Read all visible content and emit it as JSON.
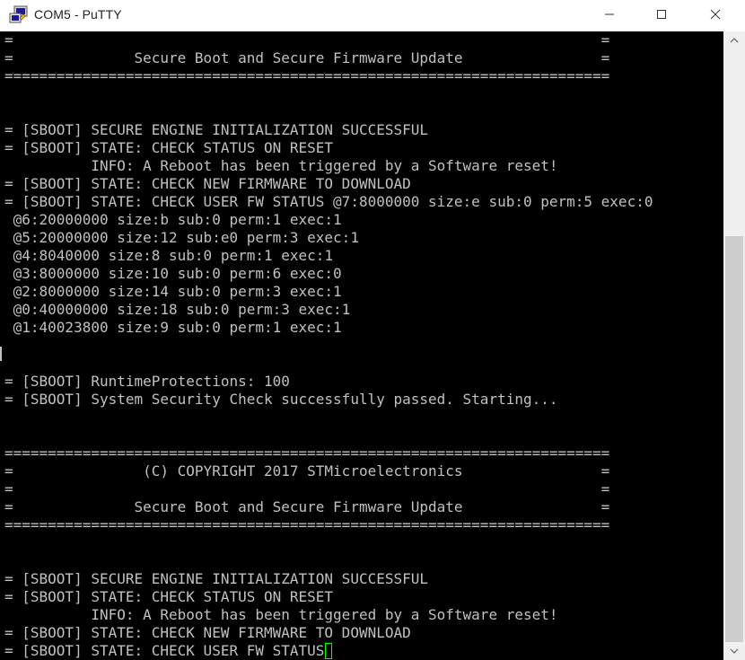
{
  "window": {
    "title": "COM5 - PuTTY"
  },
  "icons": {
    "app": "putty-app-icon",
    "minimize": "minimize-icon",
    "maximize": "maximize-icon",
    "close": "close-icon",
    "scroll_up": "scroll-up-arrow-icon",
    "scroll_down": "scroll-down-arrow-icon"
  },
  "colors": {
    "terminal_background": "#000000",
    "terminal_text": "#c0c0c0",
    "cursor": "#00ff00"
  },
  "terminal": {
    "lines": [
      "=                                                                    =",
      "=              Secure Boot and Secure Firmware Update                =",
      "======================================================================",
      "",
      "",
      "= [SBOOT] SECURE ENGINE INITIALIZATION SUCCESSFUL",
      "= [SBOOT] STATE: CHECK STATUS ON RESET",
      "          INFO: A Reboot has been triggered by a Software reset!",
      "= [SBOOT] STATE: CHECK NEW FIRMWARE TO DOWNLOAD",
      "= [SBOOT] STATE: CHECK USER FW STATUS @7:8000000 size:e sub:0 perm:5 exec:0",
      " @6:20000000 size:b sub:0 perm:1 exec:1",
      " @5:20000000 size:12 sub:e0 perm:3 exec:1",
      " @4:8040000 size:8 sub:0 perm:1 exec:1",
      " @3:8000000 size:10 sub:0 perm:6 exec:0",
      " @2:8000000 size:14 sub:0 perm:3 exec:1",
      " @0:40000000 size:18 sub:0 perm:3 exec:1",
      " @1:40023800 size:9 sub:0 perm:1 exec:1",
      "",
      "",
      "= [SBOOT] RuntimeProtections: 100",
      "= [SBOOT] System Security Check successfully passed. Starting...",
      "",
      "",
      "======================================================================",
      "=               (C) COPYRIGHT 2017 STMicroelectronics                =",
      "=                                                                    =",
      "=              Secure Boot and Secure Firmware Update                =",
      "======================================================================",
      "",
      "",
      "= [SBOOT] SECURE ENGINE INITIALIZATION SUCCESSFUL",
      "= [SBOOT] STATE: CHECK STATUS ON RESET",
      "          INFO: A Reboot has been triggered by a Software reset!",
      "= [SBOOT] STATE: CHECK NEW FIRMWARE TO DOWNLOAD",
      "= [SBOOT] STATE: CHECK USER FW STATUS"
    ]
  }
}
